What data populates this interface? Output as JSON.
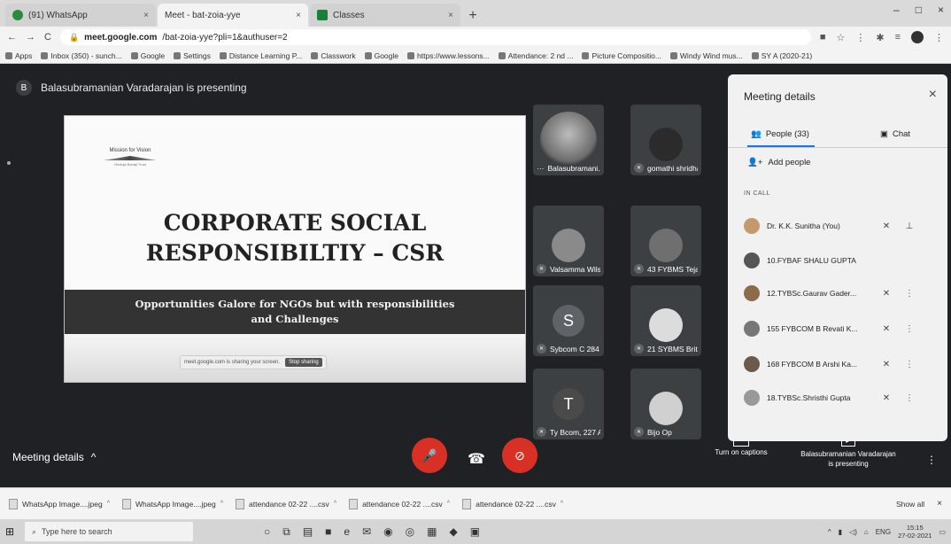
{
  "browser": {
    "tabs": [
      {
        "label": "(91) WhatsApp",
        "close": "×"
      },
      {
        "label": "Meet - bat-zoia-yye",
        "close": "×"
      },
      {
        "label": "Classes",
        "close": "×"
      }
    ],
    "new_tab": "+",
    "window_controls": [
      "–",
      "□",
      "×"
    ],
    "url_host": "meet.google.com",
    "url_path": "/bat-zoia-yye?pli=1&authuser=2",
    "bookmarks": [
      "Apps",
      "Inbox (350) - sunch...",
      "Google",
      "Settings",
      "Distance Learning P...",
      "Classwork",
      "Google",
      "https://www.lessons...",
      "Attendance: 2 nd ...",
      "Picture Compositio...",
      "Windy Wind mus...",
      "SY A (2020-21)"
    ]
  },
  "meet": {
    "presenter_initial": "B",
    "presenting_text": "Balasubramanian Varadarajan is presenting",
    "slide": {
      "logo_line1": "Mission for Vision",
      "logo_line3": "Hinduja Banaji Trust",
      "title_line1": "CORPORATE SOCIAL",
      "title_line2": "RESPONSIBILTIY – CSR",
      "subtitle_line1": "Opportunities Galore for NGOs but with responsibilities",
      "subtitle_line2": "and Challenges",
      "share_text": "meet.google.com is sharing your screen.",
      "stop_label": "Stop sharing"
    },
    "tiles": [
      {
        "name": "Balasubramani...",
        "letter": ""
      },
      {
        "name": "gomathi shridhar",
        "letter": ""
      },
      {
        "name": "Valsamma Wils...",
        "letter": ""
      },
      {
        "name": "43 FYBMS Teja...",
        "letter": ""
      },
      {
        "name": "Sybcom C 284 ...",
        "letter": "S"
      },
      {
        "name": "21 SYBMS Brit...",
        "letter": ""
      },
      {
        "name": "Ty Bcom, 227 A...",
        "letter": "T"
      },
      {
        "name": "Bijo Op",
        "letter": ""
      }
    ],
    "tile_more": "···",
    "meeting_details_label": "Meeting details",
    "meeting_details_chevron": "^",
    "captions_label": "Turn on captions",
    "captions_icon": "CC",
    "presenter_info_line1": "Balasubramanian Varadarajan",
    "presenter_info_line2": "is presenting",
    "more_icon": "⋮"
  },
  "panel": {
    "title": "Meeting details",
    "close": "×",
    "people_tab": "People (33)",
    "chat_tab": "Chat",
    "add_people": "Add people",
    "in_call": "IN CALL",
    "participants": [
      {
        "name": "Dr. K.K. Sunitha (You)"
      },
      {
        "name": "10.FYBAF SHALU GUPTA"
      },
      {
        "name": "12.TYBSc.Gaurav Gader..."
      },
      {
        "name": "155 FYBCOM B Revati K..."
      },
      {
        "name": "168 FYBCOM B Arshi Ka..."
      },
      {
        "name": "18.TYBSc.Shristhi Gupta"
      }
    ]
  },
  "downloads": {
    "items": [
      "WhatsApp Image....jpeg",
      "WhatsApp Image....jpeg",
      "attendance 02-22 ....csv",
      "attendance 02-22 ....csv",
      "attendance 02-22 ....csv"
    ],
    "show_all": "Show all",
    "close": "×"
  },
  "taskbar": {
    "search_placeholder": "Type here to search",
    "lang": "ENG",
    "time": "15:15",
    "date": "27-02-2021"
  }
}
